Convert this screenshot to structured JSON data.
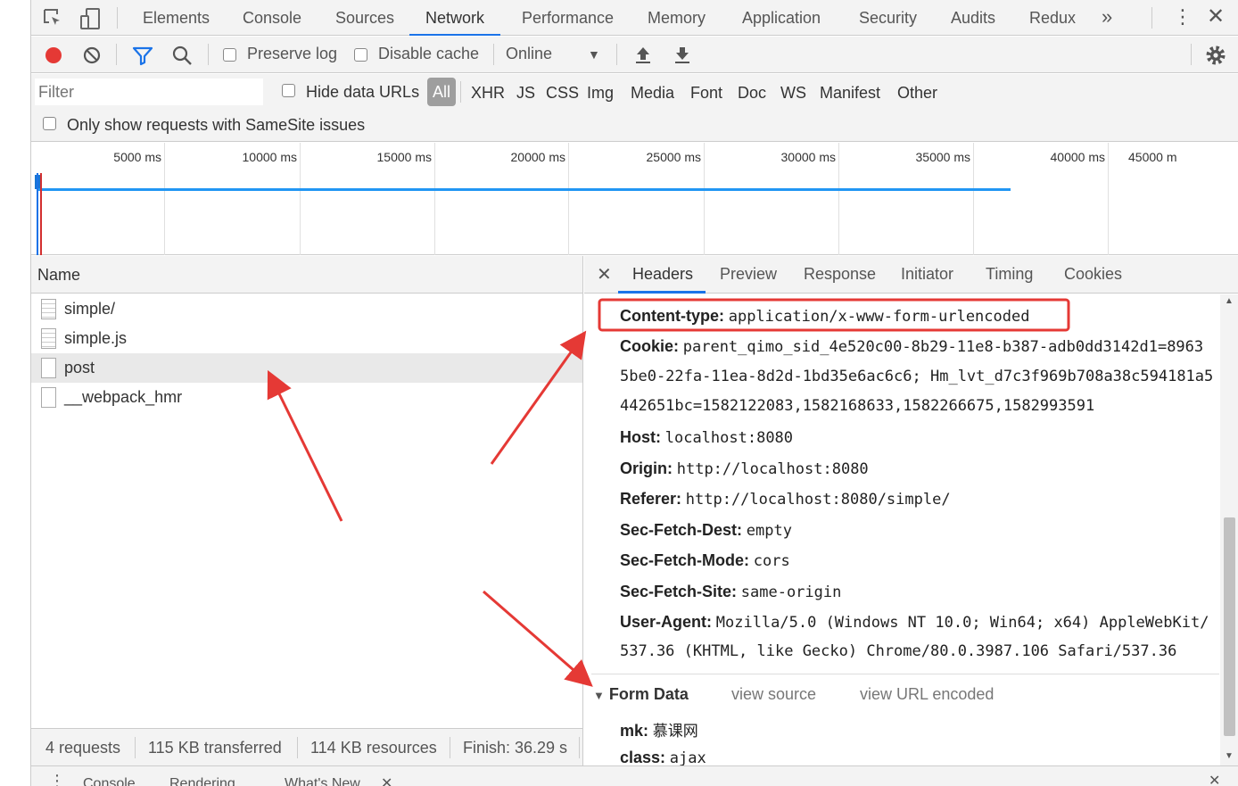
{
  "tabs": [
    "Elements",
    "Console",
    "Sources",
    "Network",
    "Performance",
    "Memory",
    "Application",
    "Security",
    "Audits",
    "Redux"
  ],
  "active_tab": "Network",
  "toolbar": {
    "preserve_log": "Preserve log",
    "disable_cache": "Disable cache",
    "throttling": "Online"
  },
  "filter": {
    "placeholder": "Filter",
    "hide_data_urls": "Hide data URLs",
    "types": [
      "All",
      "XHR",
      "JS",
      "CSS",
      "Img",
      "Media",
      "Font",
      "Doc",
      "WS",
      "Manifest",
      "Other"
    ],
    "samesite": "Only show requests with SameSite issues"
  },
  "overview": {
    "ticks": [
      "5000 ms",
      "10000 ms",
      "15000 ms",
      "20000 ms",
      "25000 ms",
      "30000 ms",
      "35000 ms",
      "40000 ms",
      "45000 m"
    ]
  },
  "requests": {
    "header": "Name",
    "items": [
      "simple/",
      "simple.js",
      "post",
      "__webpack_hmr"
    ],
    "selected": "post"
  },
  "status": {
    "requests": "4 requests",
    "transferred": "115 KB transferred",
    "resources": "114 KB resources",
    "finish": "Finish: 36.29 s"
  },
  "detail": {
    "tabs": [
      "Headers",
      "Preview",
      "Response",
      "Initiator",
      "Timing",
      "Cookies"
    ],
    "active": "Headers",
    "headers": [
      {
        "name": "Content-type:",
        "value": "application/x-www-form-urlencoded"
      },
      {
        "name": "Cookie:",
        "value": "parent_qimo_sid_4e520c00-8b29-11e8-b387-adb0dd3142d1=8963",
        "cont": [
          "5be0-22fa-11ea-8d2d-1bd35e6ac6c6; Hm_lvt_d7c3f969b708a38c594181a5",
          "442651bc=1582122083,1582168633,1582266675,1582993591"
        ]
      },
      {
        "name": "Host:",
        "value": "localhost:8080"
      },
      {
        "name": "Origin:",
        "value": "http://localhost:8080"
      },
      {
        "name": "Referer:",
        "value": "http://localhost:8080/simple/"
      },
      {
        "name": "Sec-Fetch-Dest:",
        "value": "empty"
      },
      {
        "name": "Sec-Fetch-Mode:",
        "value": "cors"
      },
      {
        "name": "Sec-Fetch-Site:",
        "value": "same-origin"
      },
      {
        "name": "User-Agent:",
        "value": "Mozilla/5.0 (Windows NT 10.0; Win64; x64) AppleWebKit/",
        "cont": [
          "537.36 (KHTML, like Gecko) Chrome/80.0.3987.106 Safari/537.36"
        ]
      }
    ],
    "form_data": {
      "title": "Form Data",
      "view_source": "view source",
      "view_url_encoded": "view URL encoded",
      "fields": [
        {
          "name": "mk:",
          "value": "慕课网"
        },
        {
          "name": "class:",
          "value": "ajax"
        }
      ]
    }
  },
  "drawer": {
    "tabs": [
      "Console",
      "Rendering",
      "What's New"
    ]
  },
  "colors": {
    "accent": "#1a73e8",
    "record": "#e53935",
    "annotation": "#e53935",
    "timeline_bar": "#2196f3"
  }
}
